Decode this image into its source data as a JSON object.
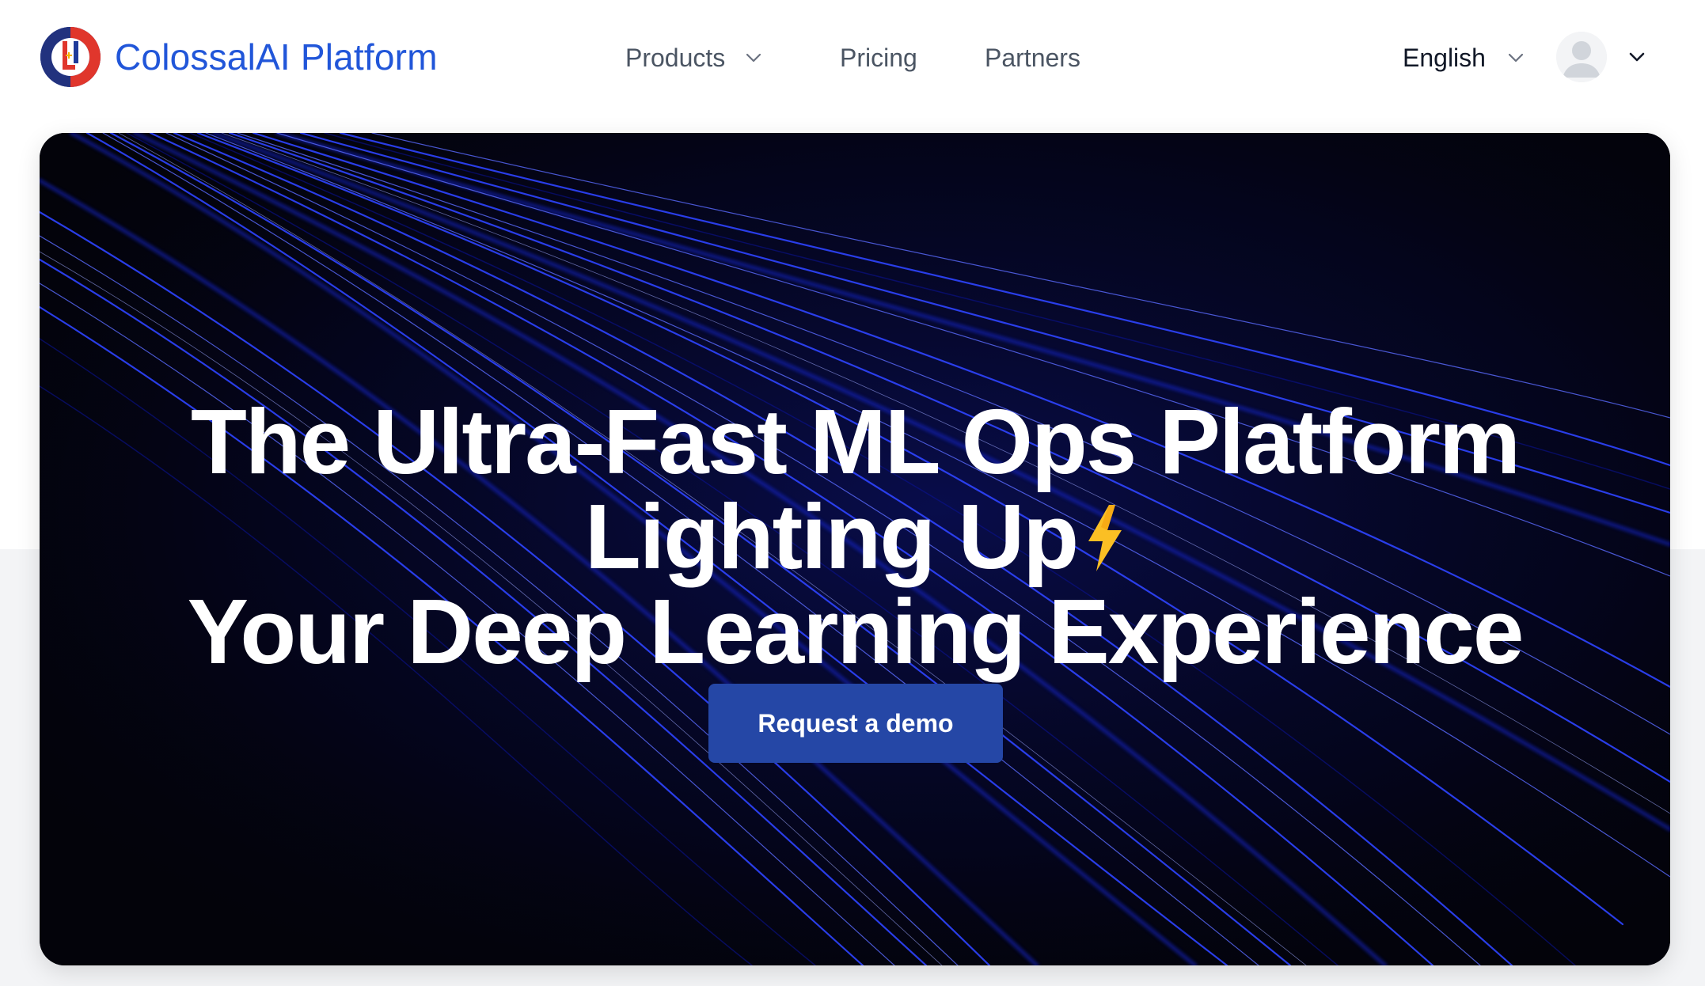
{
  "header": {
    "brand_name": "ColossalAI Platform",
    "logo_icon": "colossalai-logo-icon",
    "nav": [
      {
        "label": "Products",
        "has_dropdown": true
      },
      {
        "label": "Pricing",
        "has_dropdown": false
      },
      {
        "label": "Partners",
        "has_dropdown": false
      }
    ],
    "language": {
      "selected": "English",
      "icon": "chevron-down-icon"
    },
    "user_menu": {
      "avatar_icon": "user-avatar-icon",
      "icon": "chevron-down-icon"
    }
  },
  "hero": {
    "title_line_1": "The Ultra-Fast ML Ops Platform",
    "title_line_2": "Lighting Up",
    "title_line_3": "Your Deep Learning Experience",
    "title_icon": "lightning-bolt-icon",
    "cta_label": "Request a demo"
  },
  "colors": {
    "brand_blue": "#2156d9",
    "cta_blue": "#2547a6",
    "hero_bg": "#03030a",
    "light_trail_blue": "#1c2fff",
    "bolt_yellow": "#fbbf24",
    "page_lower_bg": "#f3f4f6"
  }
}
